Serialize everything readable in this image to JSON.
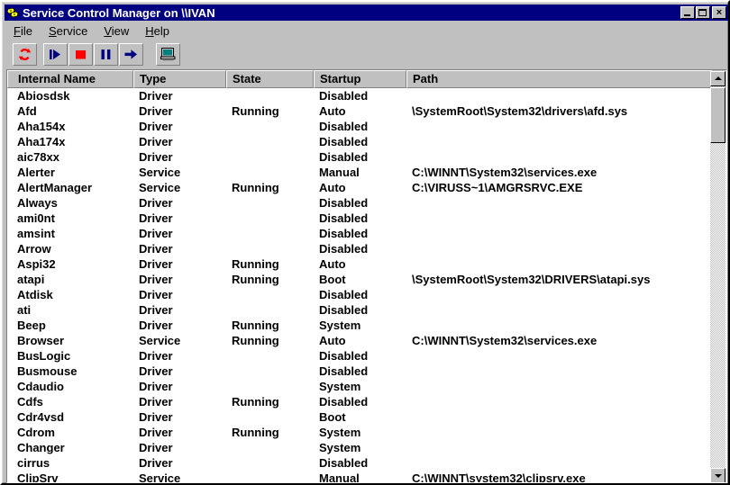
{
  "window": {
    "title": "Service Control Manager on \\\\IVAN",
    "icon": "services-gear-icon",
    "controls": {
      "minimize": "_",
      "maximize": "□",
      "close": "×"
    },
    "colors": {
      "titlebar": "#000080",
      "face": "#c0c0c0",
      "list_bg": "#ffffff",
      "toolbar_accent_blue": "#000080",
      "toolbar_accent_red": "#ff0000"
    }
  },
  "menubar": {
    "items": [
      {
        "label": "File",
        "accel": "F"
      },
      {
        "label": "Service",
        "accel": "S"
      },
      {
        "label": "View",
        "accel": "V"
      },
      {
        "label": "Help",
        "accel": "H"
      }
    ]
  },
  "toolbar": {
    "buttons": [
      {
        "name": "refresh-button",
        "icon": "refresh-icon",
        "tooltip": "Refresh"
      },
      {
        "name": "start-button",
        "icon": "play-icon",
        "tooltip": "Start"
      },
      {
        "name": "stop-button",
        "icon": "stop-icon",
        "tooltip": "Stop"
      },
      {
        "name": "pause-button",
        "icon": "pause-icon",
        "tooltip": "Pause"
      },
      {
        "name": "continue-button",
        "icon": "arrow-right-icon",
        "tooltip": "Continue"
      },
      {
        "name": "computer-button",
        "icon": "computer-icon",
        "tooltip": "Select Computer"
      }
    ]
  },
  "list": {
    "columns": [
      {
        "key": "name",
        "label": "Internal Name"
      },
      {
        "key": "type",
        "label": "Type"
      },
      {
        "key": "state",
        "label": "State"
      },
      {
        "key": "startup",
        "label": "Startup"
      },
      {
        "key": "path",
        "label": "Path"
      }
    ],
    "rows": [
      {
        "name": "Abiosdsk",
        "type": "Driver",
        "state": "",
        "startup": "Disabled",
        "path": ""
      },
      {
        "name": "Afd",
        "type": "Driver",
        "state": "Running",
        "startup": "Auto",
        "path": "\\SystemRoot\\System32\\drivers\\afd.sys"
      },
      {
        "name": "Aha154x",
        "type": "Driver",
        "state": "",
        "startup": "Disabled",
        "path": ""
      },
      {
        "name": "Aha174x",
        "type": "Driver",
        "state": "",
        "startup": "Disabled",
        "path": ""
      },
      {
        "name": "aic78xx",
        "type": "Driver",
        "state": "",
        "startup": "Disabled",
        "path": ""
      },
      {
        "name": "Alerter",
        "type": "Service",
        "state": "",
        "startup": "Manual",
        "path": "C:\\WINNT\\System32\\services.exe"
      },
      {
        "name": "AlertManager",
        "type": "Service",
        "state": "Running",
        "startup": "Auto",
        "path": "C:\\VIRUSS~1\\AMGRSRVC.EXE"
      },
      {
        "name": "Always",
        "type": "Driver",
        "state": "",
        "startup": "Disabled",
        "path": ""
      },
      {
        "name": "ami0nt",
        "type": "Driver",
        "state": "",
        "startup": "Disabled",
        "path": ""
      },
      {
        "name": "amsint",
        "type": "Driver",
        "state": "",
        "startup": "Disabled",
        "path": ""
      },
      {
        "name": "Arrow",
        "type": "Driver",
        "state": "",
        "startup": "Disabled",
        "path": ""
      },
      {
        "name": "Aspi32",
        "type": "Driver",
        "state": "Running",
        "startup": "Auto",
        "path": ""
      },
      {
        "name": "atapi",
        "type": "Driver",
        "state": "Running",
        "startup": "Boot",
        "path": "\\SystemRoot\\System32\\DRIVERS\\atapi.sys"
      },
      {
        "name": "Atdisk",
        "type": "Driver",
        "state": "",
        "startup": "Disabled",
        "path": ""
      },
      {
        "name": "ati",
        "type": "Driver",
        "state": "",
        "startup": "Disabled",
        "path": ""
      },
      {
        "name": "Beep",
        "type": "Driver",
        "state": "Running",
        "startup": "System",
        "path": ""
      },
      {
        "name": "Browser",
        "type": "Service",
        "state": "Running",
        "startup": "Auto",
        "path": "C:\\WINNT\\System32\\services.exe"
      },
      {
        "name": "BusLogic",
        "type": "Driver",
        "state": "",
        "startup": "Disabled",
        "path": ""
      },
      {
        "name": "Busmouse",
        "type": "Driver",
        "state": "",
        "startup": "Disabled",
        "path": ""
      },
      {
        "name": "Cdaudio",
        "type": "Driver",
        "state": "",
        "startup": "System",
        "path": ""
      },
      {
        "name": "Cdfs",
        "type": "Driver",
        "state": "Running",
        "startup": "Disabled",
        "path": ""
      },
      {
        "name": "Cdr4vsd",
        "type": "Driver",
        "state": "",
        "startup": "Boot",
        "path": ""
      },
      {
        "name": "Cdrom",
        "type": "Driver",
        "state": "Running",
        "startup": "System",
        "path": ""
      },
      {
        "name": "Changer",
        "type": "Driver",
        "state": "",
        "startup": "System",
        "path": ""
      },
      {
        "name": "cirrus",
        "type": "Driver",
        "state": "",
        "startup": "Disabled",
        "path": ""
      },
      {
        "name": "ClipSrv",
        "type": "Service",
        "state": "",
        "startup": "Manual",
        "path": "C:\\WINNT\\system32\\clipsrv.exe"
      }
    ]
  },
  "scrollbar": {
    "up_arrow": "▲",
    "down_arrow": "▼"
  }
}
